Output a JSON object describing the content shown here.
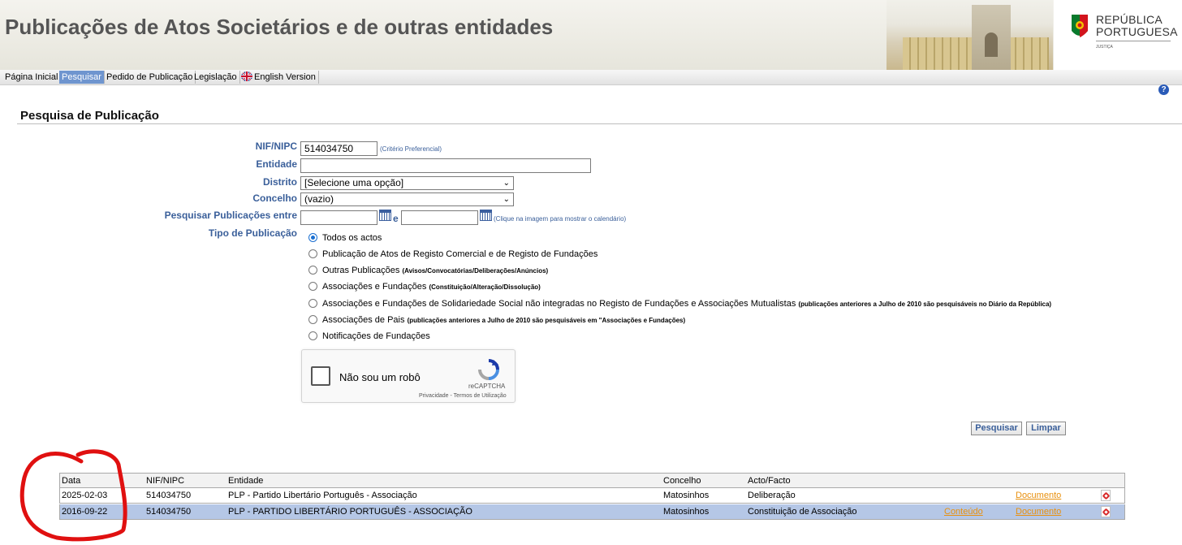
{
  "header": {
    "title": "Publicações de Atos Societários e de outras entidades",
    "logo_line1": "REPÚBLICA",
    "logo_line2": "PORTUGUESA",
    "logo_line3": "JUSTIÇA"
  },
  "nav": {
    "items": [
      {
        "label": "Página Inicial"
      },
      {
        "label": "Pesquisar",
        "active": true
      },
      {
        "label": "Pedido de Publicação"
      },
      {
        "label": "Legislação"
      },
      {
        "label": "English Version",
        "icon": "uk-flag-icon"
      }
    ]
  },
  "help_icon": "?",
  "page_heading": "Pesquisa de Publicação",
  "form": {
    "nif_label": "NIF/NIPC",
    "nif_value": "514034750",
    "nif_hint": "(Critério Preferencial)",
    "entidade_label": "Entidade",
    "entidade_value": "",
    "distrito_label": "Distrito",
    "distrito_value": "[Selecione uma opção]",
    "concelho_label": "Concelho",
    "concelho_value": "(vazio)",
    "datas_label": "Pesquisar Publicações entre",
    "datas_sep": "e",
    "datas_hint": "(Clique na imagem para mostrar o calendário)",
    "tipo_label": "Tipo de Publicação",
    "tipo_options": [
      {
        "label": "Todos os actos",
        "note": "",
        "selected": true
      },
      {
        "label": "Publicação de Atos de Registo Comercial e de Registo de Fundações",
        "note": "",
        "selected": false
      },
      {
        "label": "Outras Publicações",
        "note": "(Avisos/Convocatórias/Deliberações/Anúncios)",
        "selected": false
      },
      {
        "label": "Associações e Fundações",
        "note": "(Constituição/Alteração/Dissolução)",
        "selected": false
      },
      {
        "label": "Associações e Fundações de Solidariedade Social não integradas no Registo de Fundações e Associações Mutualistas",
        "note": "(publicações anteriores a Julho de 2010 são pesquisáveis no Diário da República)",
        "selected": false
      },
      {
        "label": "Associações de Pais",
        "note": "(publicações anteriores a Julho de 2010 são pesquisáveis em \"Associações e Fundações)",
        "selected": false
      },
      {
        "label": "Notificações de Fundações",
        "note": "",
        "selected": false
      }
    ]
  },
  "captcha": {
    "label": "Não sou um robô",
    "brand": "reCAPTCHA",
    "links": "Privacidade - Termos de Utilização"
  },
  "buttons": {
    "search": "Pesquisar",
    "clear": "Limpar"
  },
  "results": {
    "columns": [
      "Data",
      "NIF/NIPC",
      "Entidade",
      "Concelho",
      "Acto/Facto"
    ],
    "rows": [
      {
        "data": "2025-02-03",
        "nif": "514034750",
        "entidade": "PLP - Partido Libertário Português - Associação",
        "concelho": "Matosinhos",
        "acto": "Deliberação",
        "conteudo": "",
        "documento": "Documento"
      },
      {
        "data": "2016-09-22",
        "nif": "514034750",
        "entidade": "PLP - PARTIDO LIBERTÁRIO PORTUGUÊS - ASSOCIAÇÃO",
        "concelho": "Matosinhos",
        "acto": "Constituição de Associação",
        "conteudo": "Conteúdo",
        "documento": "Documento"
      }
    ]
  },
  "colors": {
    "label_blue": "#3a5f9a",
    "nav_active": "#6f95cf",
    "row_highlight": "#b5c7e6",
    "link_orange": "#e8900e",
    "annotation_red": "#e01010"
  }
}
